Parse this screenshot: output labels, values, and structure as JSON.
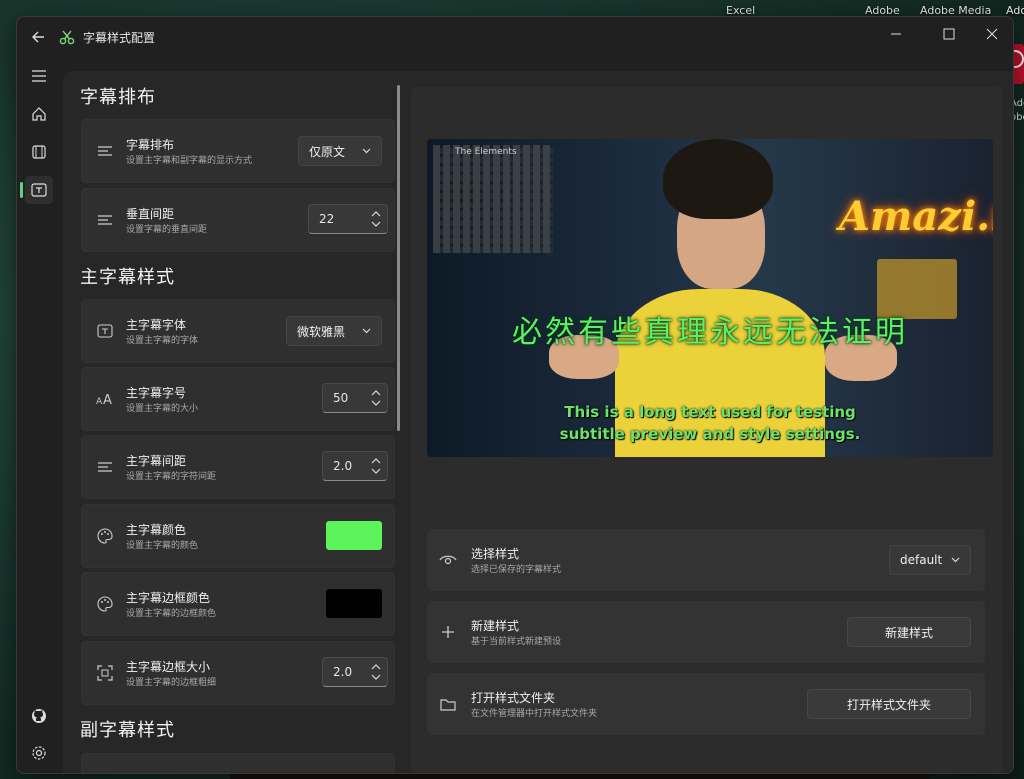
{
  "desktop": {
    "labels": [
      "Excel",
      "Adobe",
      "Adobe Media",
      "Ado"
    ],
    "side_labels": [
      "Ado",
      "obe"
    ]
  },
  "window": {
    "title": "字幕样式配置",
    "app_icon": "scissors-icon"
  },
  "nav": {
    "items": [
      "menu-icon",
      "home-icon",
      "film-icon",
      "subtitle-icon",
      "github-icon",
      "settings-icon"
    ],
    "active": "subtitle-icon"
  },
  "layout_section": {
    "title": "字幕排布",
    "items": [
      {
        "title": "字幕排布",
        "desc": "设置主字幕和副字幕的显示方式",
        "value": "仅原文"
      },
      {
        "title": "垂直间距",
        "desc": "设置字幕的垂直间距",
        "value": "22"
      }
    ]
  },
  "main_section": {
    "title": "主字幕样式",
    "items": [
      {
        "title": "主字幕字体",
        "desc": "设置主字幕的字体",
        "value": "微软雅黑"
      },
      {
        "title": "主字幕字号",
        "desc": "设置主字幕的大小",
        "value": "50"
      },
      {
        "title": "主字幕间距",
        "desc": "设置主字幕的字符间距",
        "value": "2.0"
      },
      {
        "title": "主字幕颜色",
        "desc": "设置主字幕的颜色",
        "color": "#5cf45a"
      },
      {
        "title": "主字幕边框颜色",
        "desc": "设置主字幕的边框颜色",
        "color": "#000000"
      },
      {
        "title": "主字幕边框大小",
        "desc": "设置主字幕的边框粗细",
        "value": "2.0"
      }
    ]
  },
  "secondary_section": {
    "title": "副字幕样式"
  },
  "preview": {
    "board_title": "The Elements",
    "neon_sign": "Amazi.n",
    "main_subtitle": "必然有些真理永远无法证明",
    "secondary_subtitle_line1": "This is a long text used for testing",
    "secondary_subtitle_line2": "subtitle preview and style settings."
  },
  "style_actions": [
    {
      "title": "选择样式",
      "desc": "选择已保存的字幕样式",
      "control": "default",
      "icon": "eye-icon"
    },
    {
      "title": "新建样式",
      "desc": "基于当前样式新建预设",
      "control": "新建样式",
      "icon": "plus-icon"
    },
    {
      "title": "打开样式文件夹",
      "desc": "在文件管理器中打开样式文件夹",
      "control": "打开样式文件夹",
      "icon": "folder-icon"
    }
  ],
  "colors": {
    "accent": "#5fd08a",
    "main_subtitle_color": "#5cf45a",
    "border_color": "#000000"
  }
}
